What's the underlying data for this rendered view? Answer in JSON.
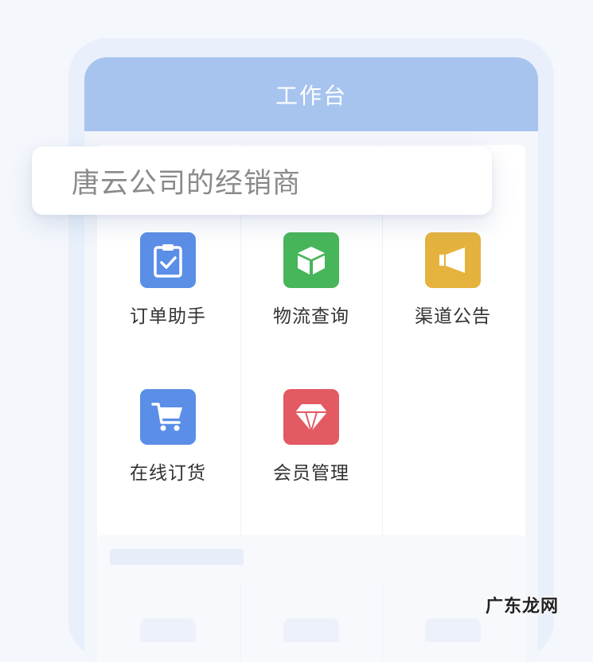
{
  "header": {
    "title": "工作台"
  },
  "search": {
    "text": "唐云公司的经销商"
  },
  "grid": {
    "items": [
      {
        "label": "订单助手",
        "icon": "clipboard-check-icon",
        "color": "#5b8ee6"
      },
      {
        "label": "物流查询",
        "icon": "package-box-icon",
        "color": "#47b559"
      },
      {
        "label": "渠道公告",
        "icon": "megaphone-icon",
        "color": "#e5b33d"
      },
      {
        "label": "在线订货",
        "icon": "shopping-cart-icon",
        "color": "#5b8ee6"
      },
      {
        "label": "会员管理",
        "icon": "diamond-icon",
        "color": "#e35a63"
      }
    ]
  },
  "watermark": {
    "text": "广东龙网"
  }
}
